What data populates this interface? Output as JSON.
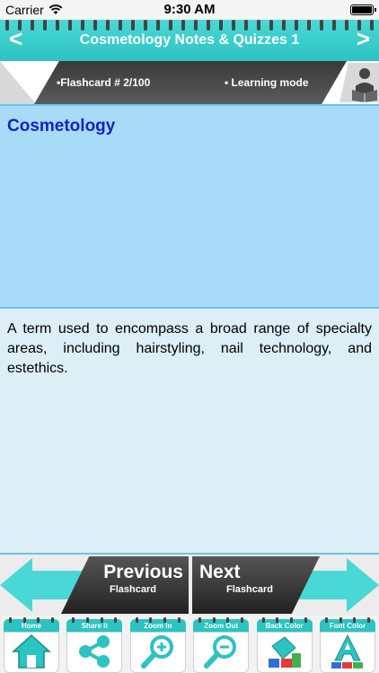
{
  "status_bar": {
    "carrier": "Carrier",
    "time": "9:30 AM"
  },
  "header": {
    "title": "Cosmetology Notes & Quizzes 1",
    "prev_arrow": "<",
    "next_arrow": ">"
  },
  "info_bar": {
    "flashcard_label": "•Flashcard #  2/100",
    "mode_label": "• Learning mode"
  },
  "card": {
    "term": "Cosmetology",
    "definition": "A term used to encompass a broad range of specialty areas, including hairstyling, nail technology, and estethics."
  },
  "navigation": {
    "previous_main": "Previous",
    "previous_sub": "Flashcard",
    "next_main": "Next",
    "next_sub": "Flashcard"
  },
  "toolbar": {
    "home": "Home",
    "share": "Share it",
    "zoom_in": "Zoom In",
    "zoom_out": "Zoom Out",
    "back_color": "Back Color",
    "font_color": "Font Color"
  },
  "colors": {
    "accent": "#2cc3c1",
    "term_panel": "#a8dbf8",
    "term_text": "#1423c4",
    "definition_bg": "#dceef6"
  },
  "icons": [
    "wifi-icon",
    "battery-icon",
    "reader-icon",
    "home-icon",
    "share-icon",
    "zoom-in-icon",
    "zoom-out-icon",
    "back-color-icon",
    "font-color-icon"
  ]
}
